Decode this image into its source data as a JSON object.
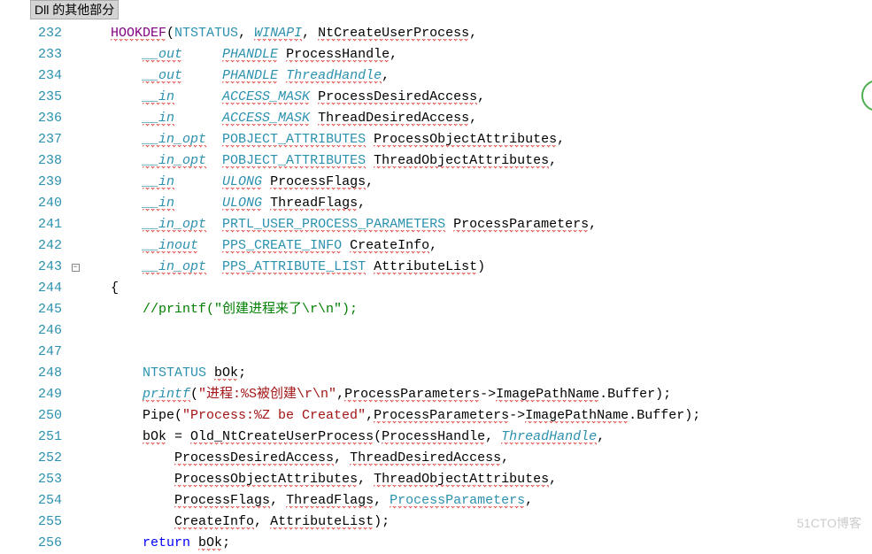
{
  "top_bar_text": "Dll 的其他部分",
  "watermark": "51CTO博客",
  "fold_glyph": "−",
  "lines": [
    {
      "n": 232,
      "fold": false,
      "tokens": [
        {
          "c": "t-ident",
          "t": "   "
        },
        {
          "c": "t-purple squiggle",
          "t": "HOOKDEF"
        },
        {
          "c": "t-black",
          "t": "("
        },
        {
          "c": "t-type-n",
          "t": "NTSTATUS"
        },
        {
          "c": "t-black",
          "t": ", "
        },
        {
          "c": "t-type squiggle",
          "t": "WINAPI"
        },
        {
          "c": "t-black",
          "t": ", "
        },
        {
          "c": "t-ident squiggle",
          "t": "NtCreateUserProcess"
        },
        {
          "c": "t-black",
          "t": ","
        }
      ]
    },
    {
      "n": 233,
      "fold": false,
      "tokens": [
        {
          "c": "t-ident",
          "t": "       "
        },
        {
          "c": "t-type squiggle",
          "t": "__out"
        },
        {
          "c": "t-ident",
          "t": "     "
        },
        {
          "c": "t-type squiggle",
          "t": "PHANDLE"
        },
        {
          "c": "t-ident",
          "t": " "
        },
        {
          "c": "t-ident squiggle",
          "t": "ProcessHandle"
        },
        {
          "c": "t-black",
          "t": ","
        }
      ]
    },
    {
      "n": 234,
      "fold": false,
      "tokens": [
        {
          "c": "t-ident",
          "t": "       "
        },
        {
          "c": "t-type squiggle",
          "t": "__out"
        },
        {
          "c": "t-ident",
          "t": "     "
        },
        {
          "c": "t-type squiggle",
          "t": "PHANDLE"
        },
        {
          "c": "t-ident",
          "t": " "
        },
        {
          "c": "t-type squiggle",
          "t": "ThreadHandle"
        },
        {
          "c": "t-black",
          "t": ","
        }
      ]
    },
    {
      "n": 235,
      "fold": false,
      "tokens": [
        {
          "c": "t-ident",
          "t": "       "
        },
        {
          "c": "t-type squiggle",
          "t": "__in"
        },
        {
          "c": "t-ident",
          "t": "      "
        },
        {
          "c": "t-type squiggle",
          "t": "ACCESS_MASK"
        },
        {
          "c": "t-ident",
          "t": " "
        },
        {
          "c": "t-ident squiggle",
          "t": "ProcessDesiredAccess"
        },
        {
          "c": "t-black",
          "t": ","
        }
      ]
    },
    {
      "n": 236,
      "fold": false,
      "tokens": [
        {
          "c": "t-ident",
          "t": "       "
        },
        {
          "c": "t-type squiggle",
          "t": "__in"
        },
        {
          "c": "t-ident",
          "t": "      "
        },
        {
          "c": "t-type squiggle",
          "t": "ACCESS_MASK"
        },
        {
          "c": "t-ident",
          "t": " "
        },
        {
          "c": "t-ident squiggle",
          "t": "ThreadDesiredAccess"
        },
        {
          "c": "t-black",
          "t": ","
        }
      ]
    },
    {
      "n": 237,
      "fold": false,
      "tokens": [
        {
          "c": "t-ident",
          "t": "       "
        },
        {
          "c": "t-type squiggle",
          "t": "__in_opt"
        },
        {
          "c": "t-ident",
          "t": "  "
        },
        {
          "c": "t-type-n squiggle",
          "t": "POBJECT_ATTRIBUTES"
        },
        {
          "c": "t-ident",
          "t": " "
        },
        {
          "c": "t-ident squiggle",
          "t": "ProcessObjectAttributes"
        },
        {
          "c": "t-black",
          "t": ","
        }
      ]
    },
    {
      "n": 238,
      "fold": false,
      "tokens": [
        {
          "c": "t-ident",
          "t": "       "
        },
        {
          "c": "t-type squiggle",
          "t": "__in_opt"
        },
        {
          "c": "t-ident",
          "t": "  "
        },
        {
          "c": "t-type-n squiggle",
          "t": "POBJECT_ATTRIBUTES"
        },
        {
          "c": "t-ident",
          "t": " "
        },
        {
          "c": "t-ident squiggle",
          "t": "ThreadObjectAttributes"
        },
        {
          "c": "t-black",
          "t": ","
        }
      ]
    },
    {
      "n": 239,
      "fold": false,
      "tokens": [
        {
          "c": "t-ident",
          "t": "       "
        },
        {
          "c": "t-type squiggle",
          "t": "__in"
        },
        {
          "c": "t-ident",
          "t": "      "
        },
        {
          "c": "t-type squiggle",
          "t": "ULONG"
        },
        {
          "c": "t-ident",
          "t": " "
        },
        {
          "c": "t-ident squiggle",
          "t": "ProcessFlags"
        },
        {
          "c": "t-black",
          "t": ","
        }
      ]
    },
    {
      "n": 240,
      "fold": false,
      "tokens": [
        {
          "c": "t-ident",
          "t": "       "
        },
        {
          "c": "t-type squiggle",
          "t": "__in"
        },
        {
          "c": "t-ident",
          "t": "      "
        },
        {
          "c": "t-type squiggle",
          "t": "ULONG"
        },
        {
          "c": "t-ident",
          "t": " "
        },
        {
          "c": "t-ident squiggle",
          "t": "ThreadFlags"
        },
        {
          "c": "t-black",
          "t": ","
        }
      ]
    },
    {
      "n": 241,
      "fold": false,
      "tokens": [
        {
          "c": "t-ident",
          "t": "       "
        },
        {
          "c": "t-type squiggle",
          "t": "__in_opt"
        },
        {
          "c": "t-ident",
          "t": "  "
        },
        {
          "c": "t-type-n squiggle",
          "t": "PRTL_USER_PROCESS_PARAMETERS"
        },
        {
          "c": "t-ident",
          "t": " "
        },
        {
          "c": "t-ident squiggle",
          "t": "ProcessParameters"
        },
        {
          "c": "t-black",
          "t": ","
        }
      ]
    },
    {
      "n": 242,
      "fold": false,
      "tokens": [
        {
          "c": "t-ident",
          "t": "       "
        },
        {
          "c": "t-type squiggle",
          "t": "__inout"
        },
        {
          "c": "t-ident",
          "t": "   "
        },
        {
          "c": "t-type-n squiggle",
          "t": "PPS_CREATE_INFO"
        },
        {
          "c": "t-ident",
          "t": " "
        },
        {
          "c": "t-ident squiggle",
          "t": "CreateInfo"
        },
        {
          "c": "t-black",
          "t": ","
        }
      ]
    },
    {
      "n": 243,
      "fold": true,
      "tokens": [
        {
          "c": "t-ident",
          "t": "       "
        },
        {
          "c": "t-type squiggle",
          "t": "__in_opt"
        },
        {
          "c": "t-ident",
          "t": "  "
        },
        {
          "c": "t-type-n squiggle",
          "t": "PPS_ATTRIBUTE_LIST"
        },
        {
          "c": "t-ident",
          "t": " "
        },
        {
          "c": "t-ident squiggle",
          "t": "AttributeList"
        },
        {
          "c": "t-black",
          "t": ")"
        }
      ]
    },
    {
      "n": 244,
      "fold": false,
      "tokens": [
        {
          "c": "t-ident",
          "t": "   "
        },
        {
          "c": "t-black",
          "t": "{"
        }
      ]
    },
    {
      "n": 245,
      "fold": false,
      "tokens": [
        {
          "c": "t-ident",
          "t": "       "
        },
        {
          "c": "t-comm",
          "t": "//printf(\"创建进程来了\\r\\n\");"
        }
      ]
    },
    {
      "n": 246,
      "fold": false,
      "tokens": []
    },
    {
      "n": 247,
      "fold": false,
      "tokens": []
    },
    {
      "n": 248,
      "fold": false,
      "tokens": [
        {
          "c": "t-ident",
          "t": "       "
        },
        {
          "c": "t-type-n",
          "t": "NTSTATUS"
        },
        {
          "c": "t-ident",
          "t": " "
        },
        {
          "c": "t-ident squiggle",
          "t": "bOk"
        },
        {
          "c": "t-black",
          "t": ";"
        }
      ]
    },
    {
      "n": 249,
      "fold": false,
      "tokens": [
        {
          "c": "t-ident",
          "t": "       "
        },
        {
          "c": "t-type squiggle",
          "t": "printf"
        },
        {
          "c": "t-black",
          "t": "("
        },
        {
          "c": "t-str",
          "t": "\"进程:%S被创建\\r\\n\""
        },
        {
          "c": "t-black",
          "t": ","
        },
        {
          "c": "t-ident squiggle",
          "t": "ProcessParameters"
        },
        {
          "c": "t-black",
          "t": "->"
        },
        {
          "c": "t-ident squiggle",
          "t": "ImagePathName"
        },
        {
          "c": "t-black",
          "t": "."
        },
        {
          "c": "t-ident",
          "t": "Buffer);"
        }
      ]
    },
    {
      "n": 250,
      "fold": false,
      "tokens": [
        {
          "c": "t-ident",
          "t": "       "
        },
        {
          "c": "t-ident",
          "t": "Pipe("
        },
        {
          "c": "t-str",
          "t": "\"Process:%Z be Created\""
        },
        {
          "c": "t-black",
          "t": ","
        },
        {
          "c": "t-ident squiggle",
          "t": "ProcessParameters"
        },
        {
          "c": "t-black",
          "t": "->"
        },
        {
          "c": "t-ident squiggle",
          "t": "ImagePathName"
        },
        {
          "c": "t-black",
          "t": "."
        },
        {
          "c": "t-ident",
          "t": "Buffer);"
        }
      ]
    },
    {
      "n": 251,
      "fold": false,
      "tokens": [
        {
          "c": "t-ident",
          "t": "       "
        },
        {
          "c": "t-ident squiggle",
          "t": "bOk"
        },
        {
          "c": "t-black",
          "t": " = "
        },
        {
          "c": "t-ident squiggle",
          "t": "Old_NtCreateUserProcess"
        },
        {
          "c": "t-black",
          "t": "("
        },
        {
          "c": "t-ident squiggle",
          "t": "ProcessHandle"
        },
        {
          "c": "t-black",
          "t": ", "
        },
        {
          "c": "t-type squiggle",
          "t": "ThreadHandle"
        },
        {
          "c": "t-black",
          "t": ","
        }
      ]
    },
    {
      "n": 252,
      "fold": false,
      "tokens": [
        {
          "c": "t-ident",
          "t": "           "
        },
        {
          "c": "t-ident squiggle",
          "t": "ProcessDesiredAccess"
        },
        {
          "c": "t-black",
          "t": ", "
        },
        {
          "c": "t-ident squiggle",
          "t": "ThreadDesiredAccess"
        },
        {
          "c": "t-black",
          "t": ","
        }
      ]
    },
    {
      "n": 253,
      "fold": false,
      "tokens": [
        {
          "c": "t-ident",
          "t": "           "
        },
        {
          "c": "t-ident squiggle",
          "t": "ProcessObjectAttributes"
        },
        {
          "c": "t-black",
          "t": ", "
        },
        {
          "c": "t-ident squiggle",
          "t": "ThreadObjectAttributes"
        },
        {
          "c": "t-black",
          "t": ","
        }
      ]
    },
    {
      "n": 254,
      "fold": false,
      "tokens": [
        {
          "c": "t-ident",
          "t": "           "
        },
        {
          "c": "t-ident squiggle",
          "t": "ProcessFlags"
        },
        {
          "c": "t-black",
          "t": ", "
        },
        {
          "c": "t-ident squiggle",
          "t": "ThreadFlags"
        },
        {
          "c": "t-black",
          "t": ", "
        },
        {
          "c": "t-type-n squiggle",
          "t": "ProcessParameters"
        },
        {
          "c": "t-black",
          "t": ","
        }
      ]
    },
    {
      "n": 255,
      "fold": false,
      "tokens": [
        {
          "c": "t-ident",
          "t": "           "
        },
        {
          "c": "t-ident squiggle",
          "t": "CreateInfo"
        },
        {
          "c": "t-black",
          "t": ", "
        },
        {
          "c": "t-ident squiggle",
          "t": "AttributeList"
        },
        {
          "c": "t-black",
          "t": ");"
        }
      ]
    },
    {
      "n": 256,
      "fold": false,
      "tokens": [
        {
          "c": "t-ident",
          "t": "       "
        },
        {
          "c": "t-kw",
          "t": "return"
        },
        {
          "c": "t-ident",
          "t": " "
        },
        {
          "c": "t-ident squiggle",
          "t": "bOk"
        },
        {
          "c": "t-black",
          "t": ";"
        }
      ]
    }
  ]
}
